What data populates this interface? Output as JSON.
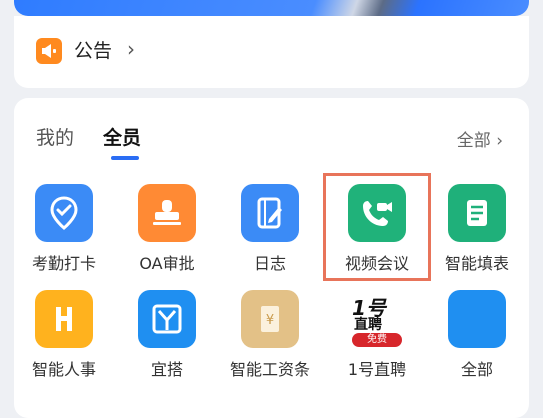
{
  "notice": {
    "label": "公告",
    "chevron": "›"
  },
  "tabs": {
    "mine": "我的",
    "all": "全员"
  },
  "all_link": "全部 ›",
  "apps": [
    {
      "label": "考勤打卡",
      "icon": "location-check-icon",
      "color": "#3b8bf6"
    },
    {
      "label": "OA审批",
      "icon": "stamp-icon",
      "color": "#ff8a34"
    },
    {
      "label": "日志",
      "icon": "notebook-pen-icon",
      "color": "#3b8bf6"
    },
    {
      "label": "视频会议",
      "icon": "video-call-icon",
      "color": "#20b27a"
    },
    {
      "label": "智能填表",
      "icon": "form-icon",
      "color": "#1fb07a"
    },
    {
      "label": "智能人事",
      "icon": "hr-h-icon",
      "color": "#ffb21e"
    },
    {
      "label": "宜搭",
      "icon": "yida-icon",
      "color": "#1f8ff1"
    },
    {
      "label": "智能工资条",
      "icon": "payslip-icon",
      "color": "#e3c187"
    },
    {
      "label": "1号直聘",
      "icon": "hiring-logo-icon",
      "logo_top": "1号",
      "logo_mid": "直聘",
      "logo_badge": "免费"
    },
    {
      "label": "全部",
      "icon": "all-apps-icon",
      "color": "#1f8ff1"
    }
  ]
}
